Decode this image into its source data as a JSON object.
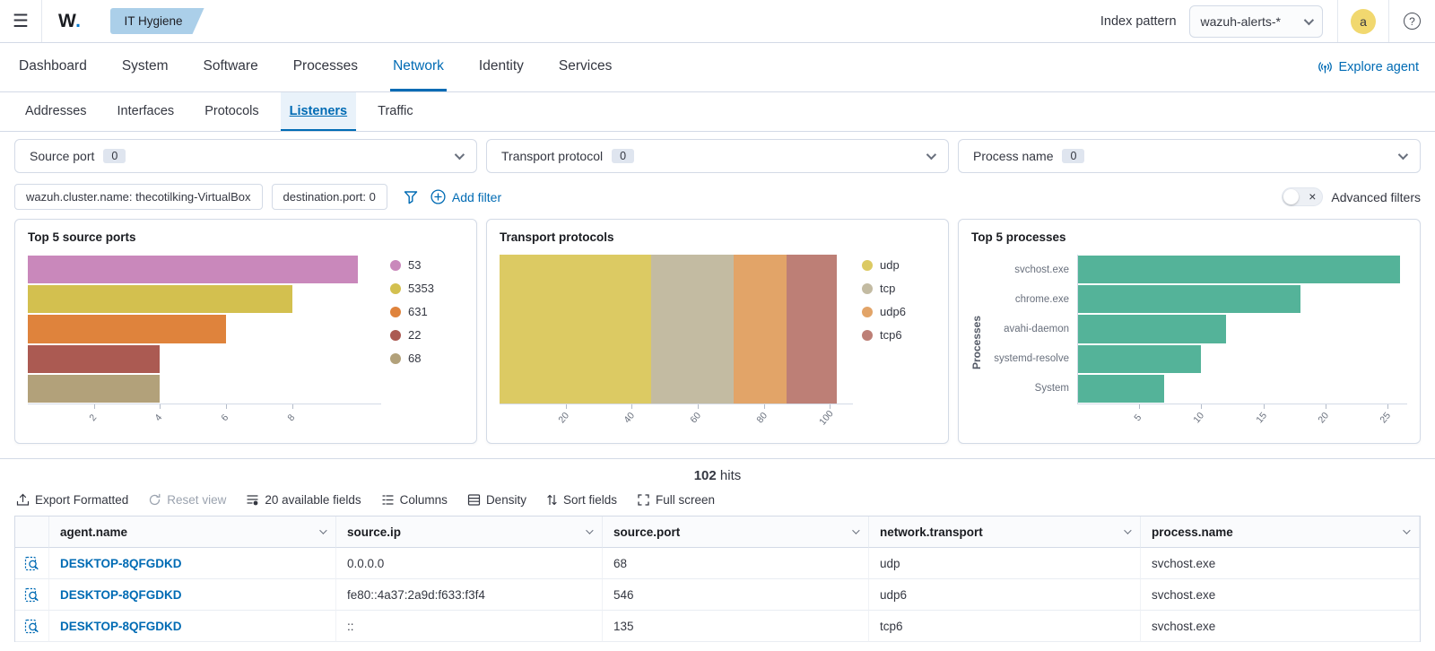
{
  "topbar": {
    "logo": "W",
    "logo_dot": ".",
    "app_badge": "IT Hygiene",
    "index_pattern_label": "Index pattern",
    "index_pattern_value": "wazuh-alerts-*",
    "avatar_initial": "a",
    "help_glyph": "?",
    "hamburger_glyph": "☰"
  },
  "nav": {
    "tabs": [
      {
        "label": "Dashboard",
        "active": false
      },
      {
        "label": "System",
        "active": false
      },
      {
        "label": "Software",
        "active": false
      },
      {
        "label": "Processes",
        "active": false
      },
      {
        "label": "Network",
        "active": true
      },
      {
        "label": "Identity",
        "active": false
      },
      {
        "label": "Services",
        "active": false
      }
    ],
    "explore_agent_label": "Explore agent"
  },
  "subnav": {
    "tabs": [
      {
        "label": "Addresses",
        "active": false
      },
      {
        "label": "Interfaces",
        "active": false
      },
      {
        "label": "Protocols",
        "active": false
      },
      {
        "label": "Listeners",
        "active": true
      },
      {
        "label": "Traffic",
        "active": false
      }
    ]
  },
  "filters": {
    "selects": [
      {
        "label": "Source port",
        "count": "0"
      },
      {
        "label": "Transport protocol",
        "count": "0"
      },
      {
        "label": "Process name",
        "count": "0"
      }
    ],
    "pills": [
      "wazuh.cluster.name: thecotilking-VirtualBox",
      "destination.port: 0"
    ],
    "add_filter_label": "Add filter",
    "advanced_filters_label": "Advanced filters",
    "toggle_x_glyph": "×"
  },
  "chart_data": [
    {
      "type": "bar",
      "orientation": "horizontal",
      "title": "Top 5 source ports",
      "categories": [
        "53",
        "5353",
        "631",
        "22",
        "68"
      ],
      "values": [
        10,
        8,
        6,
        4,
        4
      ],
      "colors": [
        "#c988bb",
        "#d3c04f",
        "#df833c",
        "#ab5a52",
        "#b2a17a"
      ],
      "xticks": [
        2,
        4,
        6,
        8
      ],
      "xmax": 10.7,
      "legend_position": "right"
    },
    {
      "type": "bar",
      "orientation": "horizontal",
      "stacked": true,
      "title": "Transport protocols",
      "series": [
        {
          "name": "udp",
          "value": 46,
          "color": "#dcca63"
        },
        {
          "name": "tcp",
          "value": 25,
          "color": "#c3bba2"
        },
        {
          "name": "udp6",
          "value": 16,
          "color": "#e2a468"
        },
        {
          "name": "tcp6",
          "value": 15,
          "color": "#bd7f76"
        }
      ],
      "xticks": [
        20,
        40,
        60,
        80,
        100
      ],
      "xmax": 107,
      "legend_position": "right"
    },
    {
      "type": "bar",
      "orientation": "horizontal",
      "title": "Top 5 processes",
      "ylabel": "Processes",
      "categories": [
        "svchost.exe",
        "chrome.exe",
        "avahi-daemon",
        "systemd-resolve",
        "System"
      ],
      "values": [
        26,
        18,
        12,
        10,
        7
      ],
      "bar_color": "#54b399",
      "xticks": [
        5,
        10,
        15,
        20,
        25
      ],
      "xmax": 26.6,
      "show_category_labels": true,
      "legend_position": "none"
    }
  ],
  "table": {
    "hits_count": "102",
    "hits_label": "hits",
    "toolbar": [
      "Export Formatted",
      "Reset view",
      "20 available fields",
      "Columns",
      "Density",
      "Sort fields",
      "Full screen"
    ],
    "columns": [
      "agent.name",
      "source.ip",
      "source.port",
      "network.transport",
      "process.name"
    ],
    "rows": [
      [
        "DESKTOP-8QFGDKD",
        "0.0.0.0",
        "68",
        "udp",
        "svchost.exe"
      ],
      [
        "DESKTOP-8QFGDKD",
        "fe80::4a37:2a9d:f633:f3f4",
        "546",
        "udp6",
        "svchost.exe"
      ],
      [
        "DESKTOP-8QFGDKD",
        "::",
        "135",
        "tcp6",
        "svchost.exe"
      ]
    ]
  },
  "colors": {
    "accent_blue": "#006bb4",
    "badge_blue": "#abcfe9",
    "avatar_yellow": "#f1d86f",
    "green_bars": "#54b399",
    "border": "#d3dae6"
  }
}
